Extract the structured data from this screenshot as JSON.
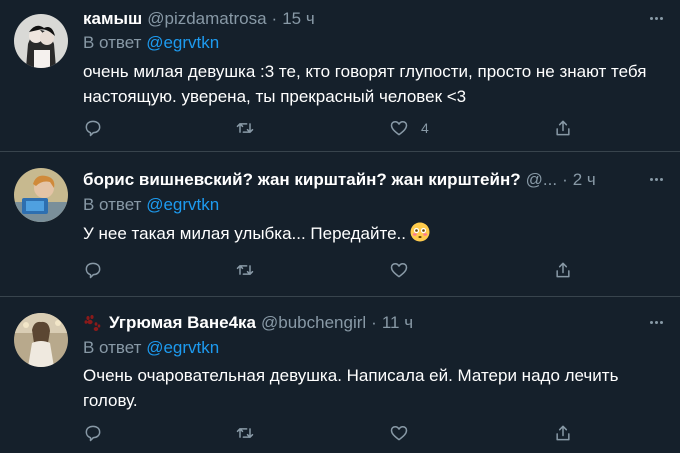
{
  "tweets": [
    {
      "name": "камыш",
      "handle": "@pizdamatrosa",
      "dot": "·",
      "time": "15 ч",
      "reply_prefix": "В ответ",
      "reply_to": "@egrvtkn",
      "text": "очень милая девушка :3 те, кто говорят глупости, просто не знают тебя настоящую. уверена, ты прекрасный человек <3",
      "likes": "4"
    },
    {
      "name": "борис вишневский? жан кирштайн? жан кирштейн?",
      "handle": "@...",
      "dot": "·",
      "time": "2 ч",
      "reply_prefix": "В ответ",
      "reply_to": "@egrvtkn",
      "text": "У нее такая милая улыбка... Передайте..",
      "emoji": "flushed-face-icon",
      "likes": ""
    },
    {
      "name": "Угрюмая Ване4ка",
      "handle": "@bubchengirl",
      "dot": "·",
      "time": "11 ч",
      "reply_prefix": "В ответ",
      "reply_to": "@egrvtkn",
      "text": "Очень очаровательная девушка. Написала ей. Матери надо лечить голову.",
      "badge": "paw-prints-icon",
      "likes": ""
    }
  ],
  "icons": [
    "reply-icon",
    "retweet-icon",
    "like-icon",
    "share-icon",
    "more-icon"
  ],
  "colors": {
    "background": "#15202b",
    "secondary_text": "#8899a6",
    "link": "#1d9bf0",
    "divider": "#38444d"
  }
}
